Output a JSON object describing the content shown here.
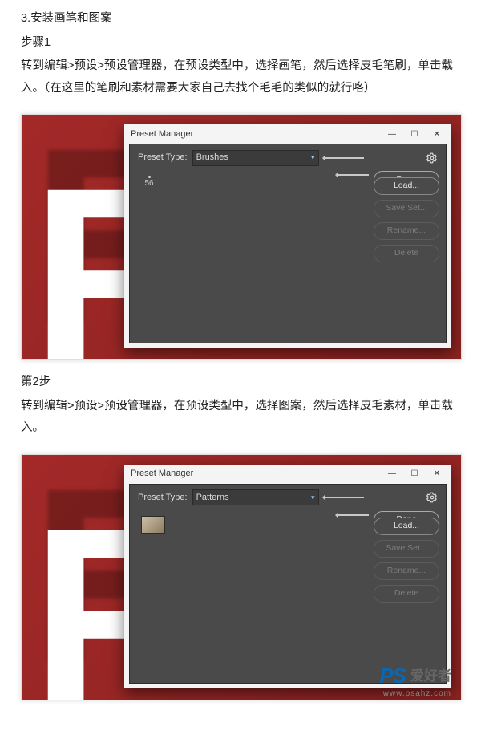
{
  "section": {
    "title": "3.安装画笔和图案",
    "step1_label": "步骤1",
    "step1_text": "转到编辑>预设>预设管理器，在预设类型中，选择画笔，然后选择皮毛笔刷，单击载入。（在这里的笔刷和素材需要大家自己去找个毛毛的类似的就行咯）",
    "step2_label": "第2步",
    "step2_text": "转到编辑>预设>预设管理器，在预设类型中，选择图案，然后选择皮毛素材，单击载入。"
  },
  "pm": {
    "title": "Preset Manager",
    "type_label": "Preset Type:",
    "brushes": "Brushes",
    "patterns": "Patterns",
    "brush_num": "56",
    "btn_done": "Done",
    "btn_load": "Load...",
    "btn_saveset": "Save Set...",
    "btn_rename": "Rename...",
    "btn_delete": "Delete"
  },
  "win": {
    "min": "—",
    "max": "☐",
    "close": "✕"
  },
  "wm": {
    "logo": "PS",
    "text": "爱好者",
    "url": "www.psahz.com"
  }
}
